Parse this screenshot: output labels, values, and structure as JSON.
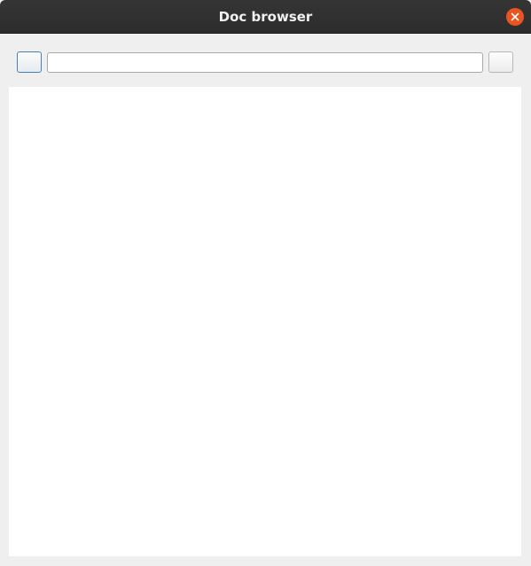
{
  "window": {
    "title": "Doc browser"
  },
  "toolbar": {
    "back_label": "",
    "forward_label": "",
    "address_value": "",
    "address_placeholder": ""
  },
  "icons": {
    "close": "close-icon"
  },
  "colors": {
    "titlebar": "#2c2c2c",
    "close_button": "#e95420",
    "window_background": "#efefef",
    "content_background": "#ffffff",
    "focus_border": "#4b7fb0"
  }
}
